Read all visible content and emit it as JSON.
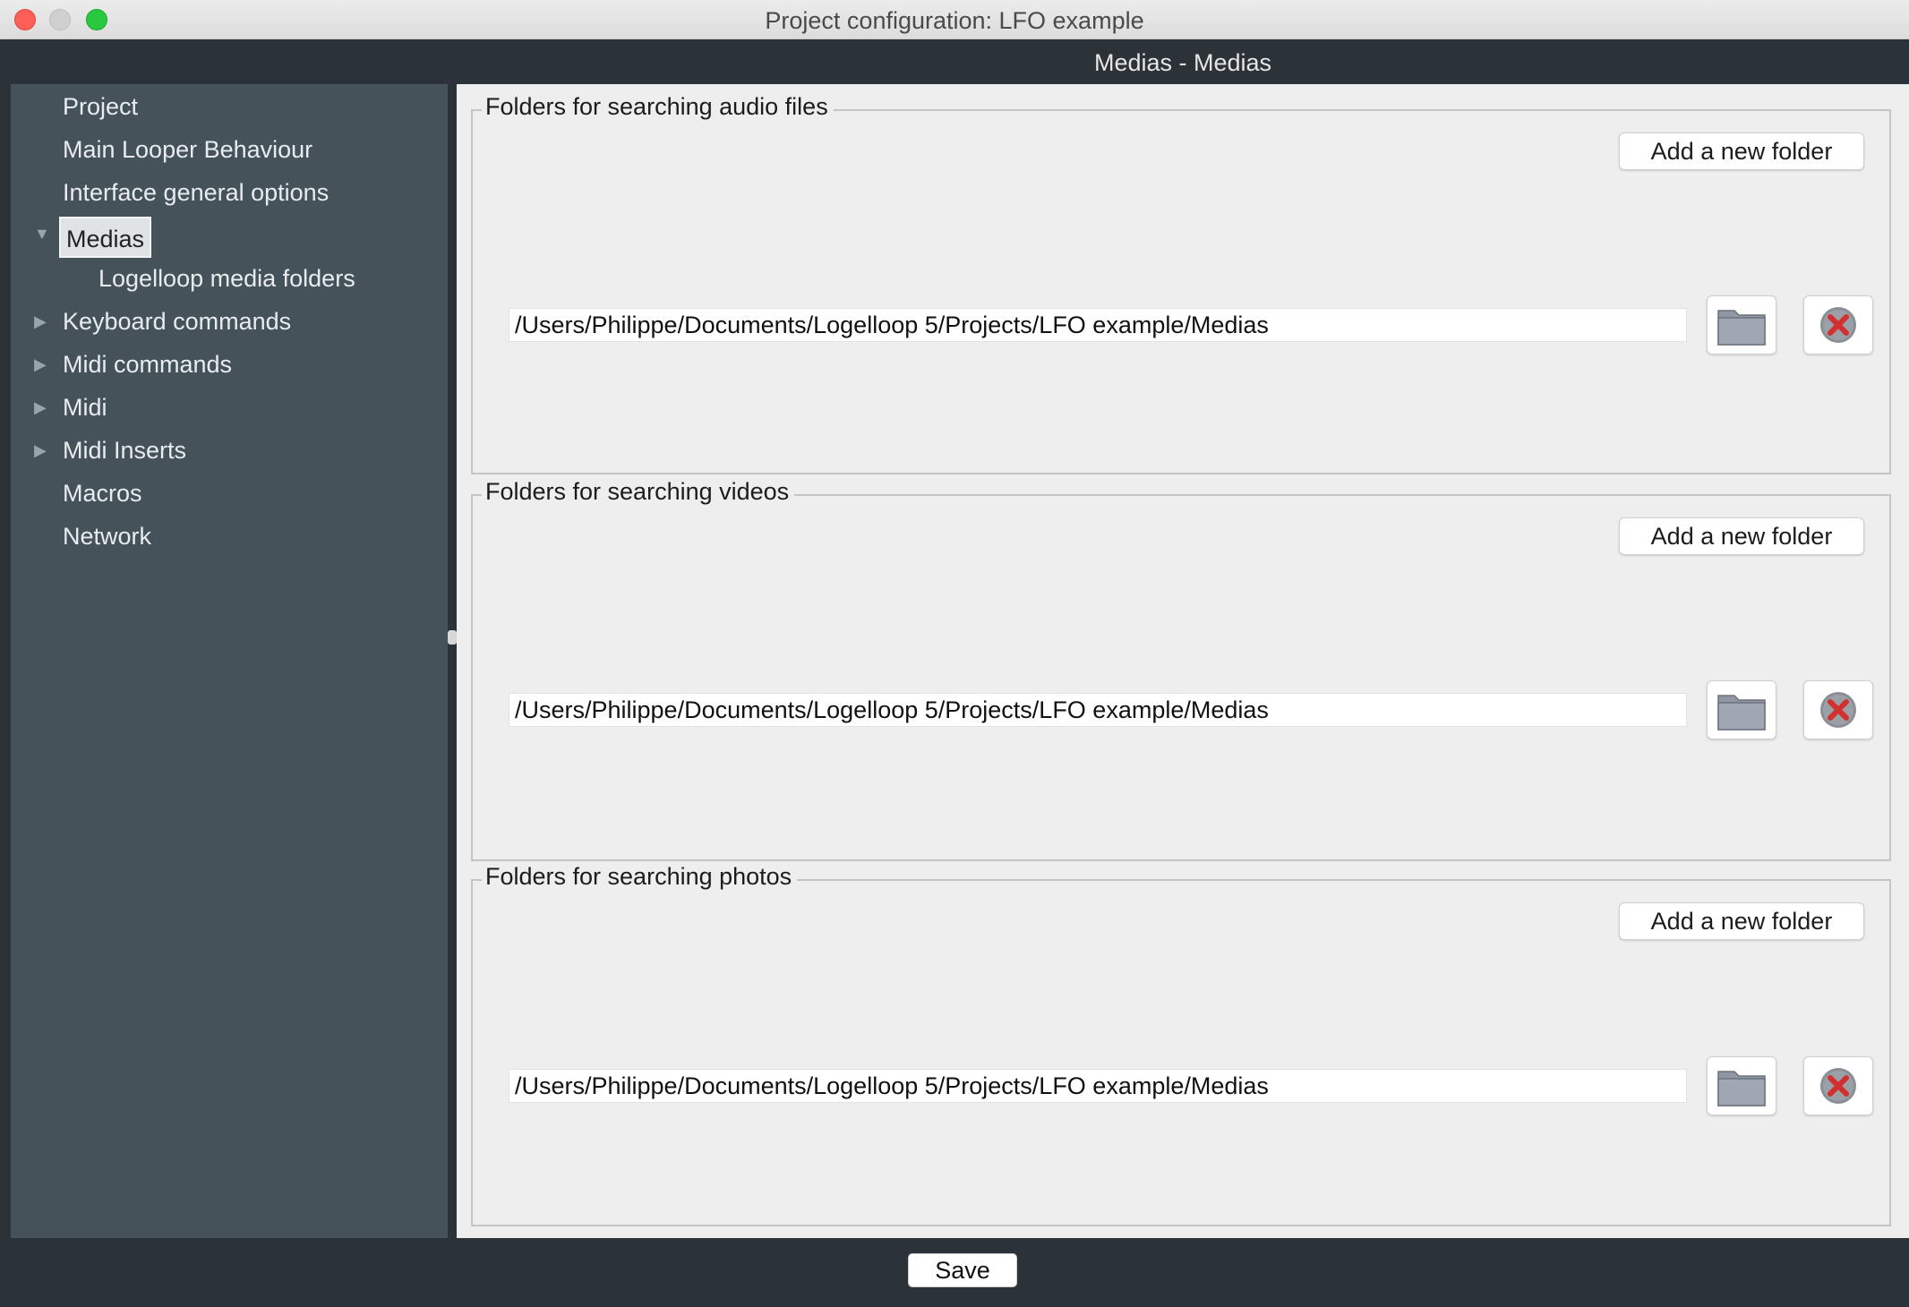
{
  "window": {
    "title": "Project configuration: LFO example"
  },
  "header": {
    "title": "Medias - Medias"
  },
  "sidebar": {
    "items": [
      {
        "label": "Project",
        "arrow": ""
      },
      {
        "label": "Main Looper Behaviour",
        "arrow": ""
      },
      {
        "label": "Interface general options",
        "arrow": ""
      },
      {
        "label": "Medias",
        "arrow": "▼",
        "selected": true
      },
      {
        "label": "Logelloop media folders",
        "arrow": "",
        "child": true
      },
      {
        "label": "Keyboard commands",
        "arrow": "▶"
      },
      {
        "label": "Midi commands",
        "arrow": "▶"
      },
      {
        "label": "Midi",
        "arrow": "▶"
      },
      {
        "label": "Midi Inserts",
        "arrow": "▶"
      },
      {
        "label": "Macros",
        "arrow": ""
      },
      {
        "label": "Network",
        "arrow": ""
      }
    ]
  },
  "groups": [
    {
      "title": "Folders for searching audio files",
      "add_label": "Add a new folder",
      "path": "/Users/Philippe/Documents/Logelloop 5/Projects/LFO example/Medias"
    },
    {
      "title": "Folders for searching videos",
      "add_label": "Add a new folder",
      "path": "/Users/Philippe/Documents/Logelloop 5/Projects/LFO example/Medias"
    },
    {
      "title": "Folders for searching photos",
      "add_label": "Add a new folder",
      "path": "/Users/Philippe/Documents/Logelloop 5/Projects/LFO example/Medias"
    }
  ],
  "footer": {
    "save_label": "Save"
  },
  "icons": {
    "folder": "folder-icon",
    "remove": "remove-icon"
  },
  "colors": {
    "sidebar_bg": "#45525a",
    "window_bg": "#2b3238",
    "content_bg": "#eeeeee",
    "remove_red": "#d32f2f"
  }
}
